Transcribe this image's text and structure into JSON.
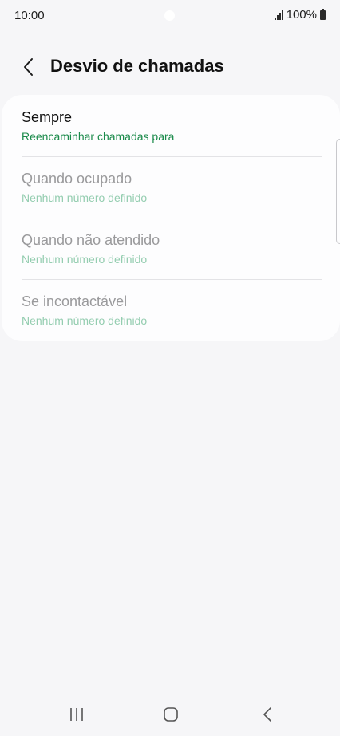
{
  "status_bar": {
    "time": "10:00",
    "battery": "100%"
  },
  "header": {
    "back_icon": "chevron-left-icon",
    "title": "Desvio de chamadas"
  },
  "options": [
    {
      "title": "Sempre",
      "subtitle": "Reencaminhar chamadas para",
      "enabled": true
    },
    {
      "title": "Quando ocupado",
      "subtitle": "Nenhum número definido",
      "enabled": false
    },
    {
      "title": "Quando não atendido",
      "subtitle": "Nenhum número definido",
      "enabled": false
    },
    {
      "title": "Se incontactável",
      "subtitle": "Nenhum número definido",
      "enabled": false
    }
  ],
  "nav_bar": {
    "recents_icon": "recents-icon",
    "home_icon": "home-icon",
    "back_icon": "back-icon"
  },
  "colors": {
    "background": "#f6f6f8",
    "card": "#fdfdfe",
    "accent_green": "#1a8a4a",
    "accent_green_disabled": "#94cdb0"
  }
}
